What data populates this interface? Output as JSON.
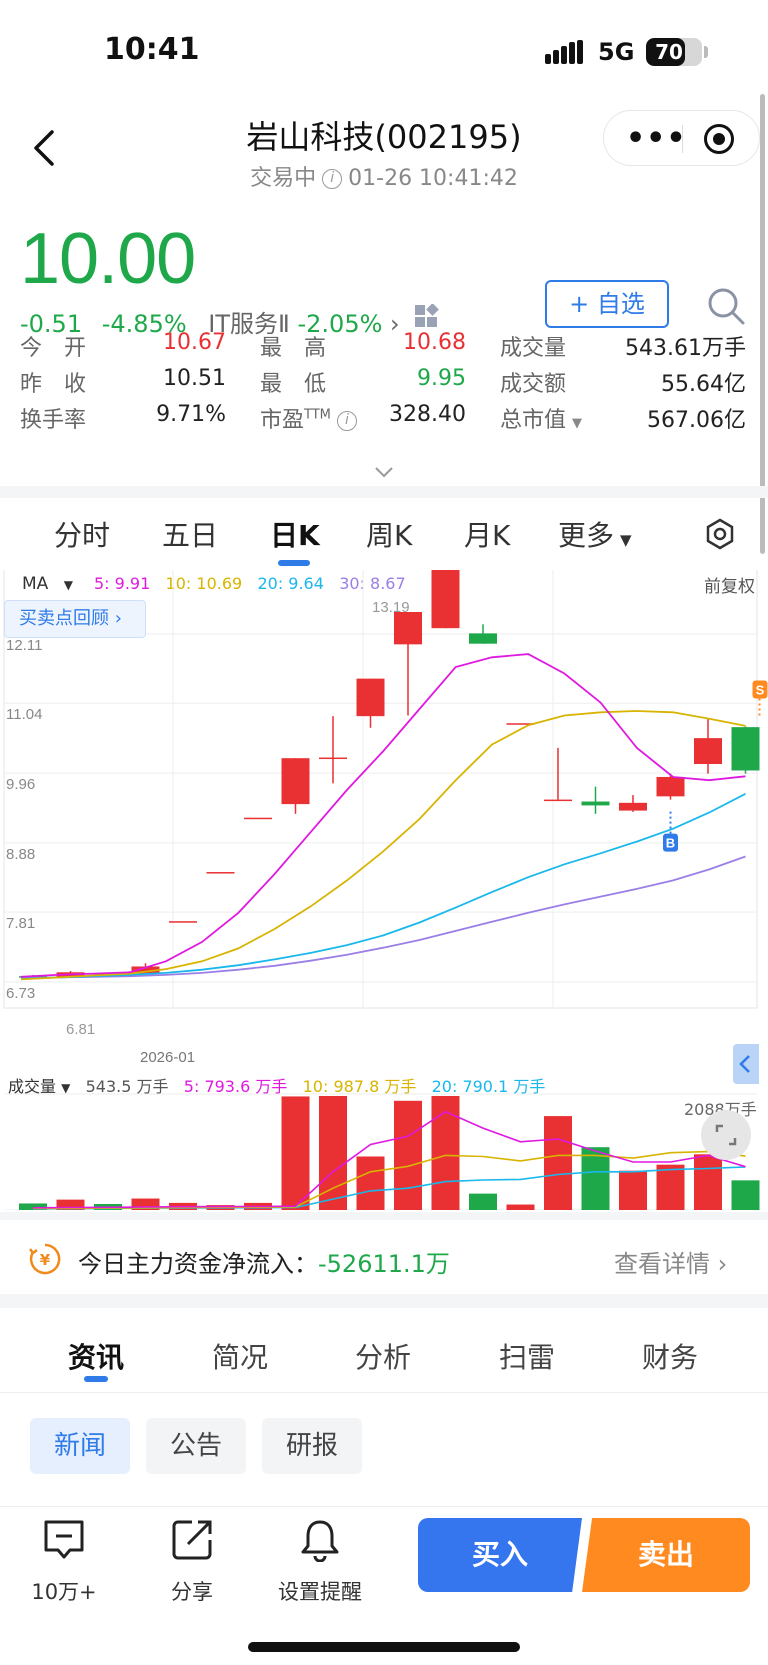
{
  "status": {
    "time": "10:41",
    "network": "5G",
    "battery": "70",
    "battery_pct": 70
  },
  "header": {
    "title": "岩山科技(002195)",
    "status_text": "交易中",
    "datetime": "01-26 10:41:42"
  },
  "quote": {
    "price": "10.00",
    "change": "-0.51",
    "change_pct": "-4.85%",
    "industry": "IT服务Ⅱ",
    "industry_chg": "-2.05%",
    "add_watch": "+ 自选"
  },
  "stats": [
    {
      "label": "今　开",
      "value": "10.67",
      "tone": "red"
    },
    {
      "label": "最　高",
      "value": "10.68",
      "tone": "red"
    },
    {
      "label": "成交量",
      "value": "543.61万手",
      "tone": ""
    },
    {
      "label": "昨　收",
      "value": "10.51",
      "tone": ""
    },
    {
      "label": "最　低",
      "value": "9.95",
      "tone": "green"
    },
    {
      "label": "成交额",
      "value": "55.64亿",
      "tone": ""
    },
    {
      "label": "换手率",
      "value": "9.71%",
      "tone": ""
    },
    {
      "label": "市盈",
      "label_sup": "TTM",
      "value": "328.40",
      "tone": ""
    },
    {
      "label": "总市值",
      "value": "567.06亿",
      "tone": ""
    }
  ],
  "ktabs": [
    "分时",
    "五日",
    "日K",
    "周K",
    "月K",
    "更多"
  ],
  "ma_legend": {
    "select": "MA",
    "ma5": "5: 9.91",
    "ma10": "10: 10.69",
    "ma20": "20: 9.64",
    "ma30": "30: 8.67",
    "adjust": "前复权"
  },
  "replay_label": "买卖点回顾",
  "vol_legend": {
    "select": "成交量",
    "vol": "543.5 万手",
    "ma5": "5: 793.6 万手",
    "ma10": "10: 987.8 万手",
    "ma20": "20: 790.1 万手",
    "max": "2088万手"
  },
  "colors": {
    "up": "#e93033",
    "down": "#1fa84a",
    "ma5": "#e019e0",
    "ma10": "#d8b400",
    "ma20": "#19b8ec",
    "ma30": "#9b7ee6",
    "accent": "#2f7be8"
  },
  "chart_data": {
    "type": "candlestick",
    "y_ticks": [
      "12.11",
      "11.04",
      "9.96",
      "8.88",
      "7.81",
      "6.73"
    ],
    "ylim": [
      6.73,
      13.19
    ],
    "x_label": "2026-01",
    "high_label": "13.19",
    "low_label": "6.81",
    "candles": [
      {
        "o": 6.82,
        "c": 6.8,
        "h": 6.84,
        "l": 6.79
      },
      {
        "o": 6.81,
        "c": 6.88,
        "h": 6.9,
        "l": 6.8
      },
      {
        "o": 6.86,
        "c": 6.84,
        "h": 6.87,
        "l": 6.83
      },
      {
        "o": 6.86,
        "c": 6.97,
        "h": 7.02,
        "l": 6.86
      },
      {
        "o": 7.67,
        "c": 7.67,
        "h": 7.67,
        "l": 7.67
      },
      {
        "o": 8.43,
        "c": 8.43,
        "h": 8.43,
        "l": 8.43
      },
      {
        "o": 9.27,
        "c": 9.27,
        "h": 9.27,
        "l": 9.27
      },
      {
        "o": 9.48,
        "c": 10.19,
        "h": 10.19,
        "l": 9.33
      },
      {
        "o": 10.2,
        "c": 10.2,
        "h": 10.84,
        "l": 9.8
      },
      {
        "o": 10.84,
        "c": 11.42,
        "h": 11.42,
        "l": 10.66
      },
      {
        "o": 11.95,
        "c": 12.45,
        "h": 12.45,
        "l": 10.85
      },
      {
        "o": 12.2,
        "c": 13.19,
        "h": 13.19,
        "l": 12.2
      },
      {
        "o": 12.12,
        "c": 11.96,
        "h": 12.26,
        "l": 11.96
      },
      {
        "o": 10.73,
        "c": 10.73,
        "h": 10.73,
        "l": 10.73
      },
      {
        "o": 9.55,
        "c": 9.55,
        "h": 10.35,
        "l": 9.55
      },
      {
        "o": 9.52,
        "c": 9.46,
        "h": 9.75,
        "l": 9.33
      },
      {
        "o": 9.38,
        "c": 9.5,
        "h": 9.62,
        "l": 9.36
      },
      {
        "o": 9.6,
        "c": 9.9,
        "h": 9.95,
        "l": 9.55
      },
      {
        "o": 10.1,
        "c": 10.5,
        "h": 10.8,
        "l": 9.95
      },
      {
        "o": 10.67,
        "c": 10.0,
        "h": 10.68,
        "l": 9.95
      }
    ],
    "ma5": [
      6.81,
      6.84,
      6.86,
      6.88,
      7.05,
      7.35,
      7.8,
      8.4,
      9.05,
      9.7,
      10.3,
      10.95,
      11.6,
      11.75,
      11.8,
      11.5,
      11.05,
      10.35,
      9.9,
      9.85,
      9.91
    ],
    "ma10": [
      6.77,
      6.8,
      6.83,
      6.86,
      6.93,
      7.05,
      7.25,
      7.55,
      7.9,
      8.3,
      8.75,
      9.25,
      9.85,
      10.4,
      10.7,
      10.85,
      10.9,
      10.92,
      10.9,
      10.8,
      10.69
    ],
    "ma20": [
      6.78,
      6.8,
      6.82,
      6.84,
      6.87,
      6.92,
      6.99,
      7.08,
      7.18,
      7.3,
      7.45,
      7.65,
      7.88,
      8.12,
      8.35,
      8.55,
      8.72,
      8.9,
      9.1,
      9.35,
      9.64
    ],
    "ma30": [
      6.79,
      6.8,
      6.81,
      6.82,
      6.84,
      6.87,
      6.92,
      6.98,
      7.06,
      7.15,
      7.26,
      7.38,
      7.52,
      7.66,
      7.8,
      7.93,
      8.05,
      8.17,
      8.3,
      8.47,
      8.67
    ],
    "volume": [
      120,
      190,
      110,
      210,
      130,
      90,
      130,
      2080,
      2088,
      980,
      2000,
      2088,
      300,
      100,
      1720,
      1150,
      720,
      830,
      1020,
      543
    ],
    "vol_ma5": [
      40,
      45,
      50,
      55,
      60,
      62,
      65,
      70,
      700,
      1200,
      1350,
      1800,
      1500,
      1250,
      1300,
      1080,
      880,
      880,
      1000,
      793.6
    ],
    "vol_ma10": [
      30,
      32,
      35,
      40,
      45,
      50,
      52,
      55,
      400,
      700,
      800,
      1000,
      980,
      900,
      1000,
      1000,
      950,
      1050,
      1070,
      987.8
    ],
    "vol_ma20": [
      20,
      25,
      30,
      35,
      38,
      40,
      42,
      45,
      200,
      350,
      400,
      520,
      550,
      560,
      650,
      700,
      700,
      740,
      760,
      790.1
    ],
    "markers": [
      {
        "index": 19,
        "label": "S",
        "position": "above"
      },
      {
        "index": 17,
        "label": "B",
        "position": "below"
      }
    ]
  },
  "flow": {
    "label": "今日主力资金净流入：",
    "value": "-52611.1万",
    "link": "查看详情"
  },
  "info_tabs": [
    "资讯",
    "简况",
    "分析",
    "扫雷",
    "财务"
  ],
  "chips": [
    "新闻",
    "公告",
    "研报"
  ],
  "bottom": {
    "comments": "10万+",
    "share": "分享",
    "alert": "设置提醒",
    "buy": "买入",
    "sell": "卖出"
  }
}
